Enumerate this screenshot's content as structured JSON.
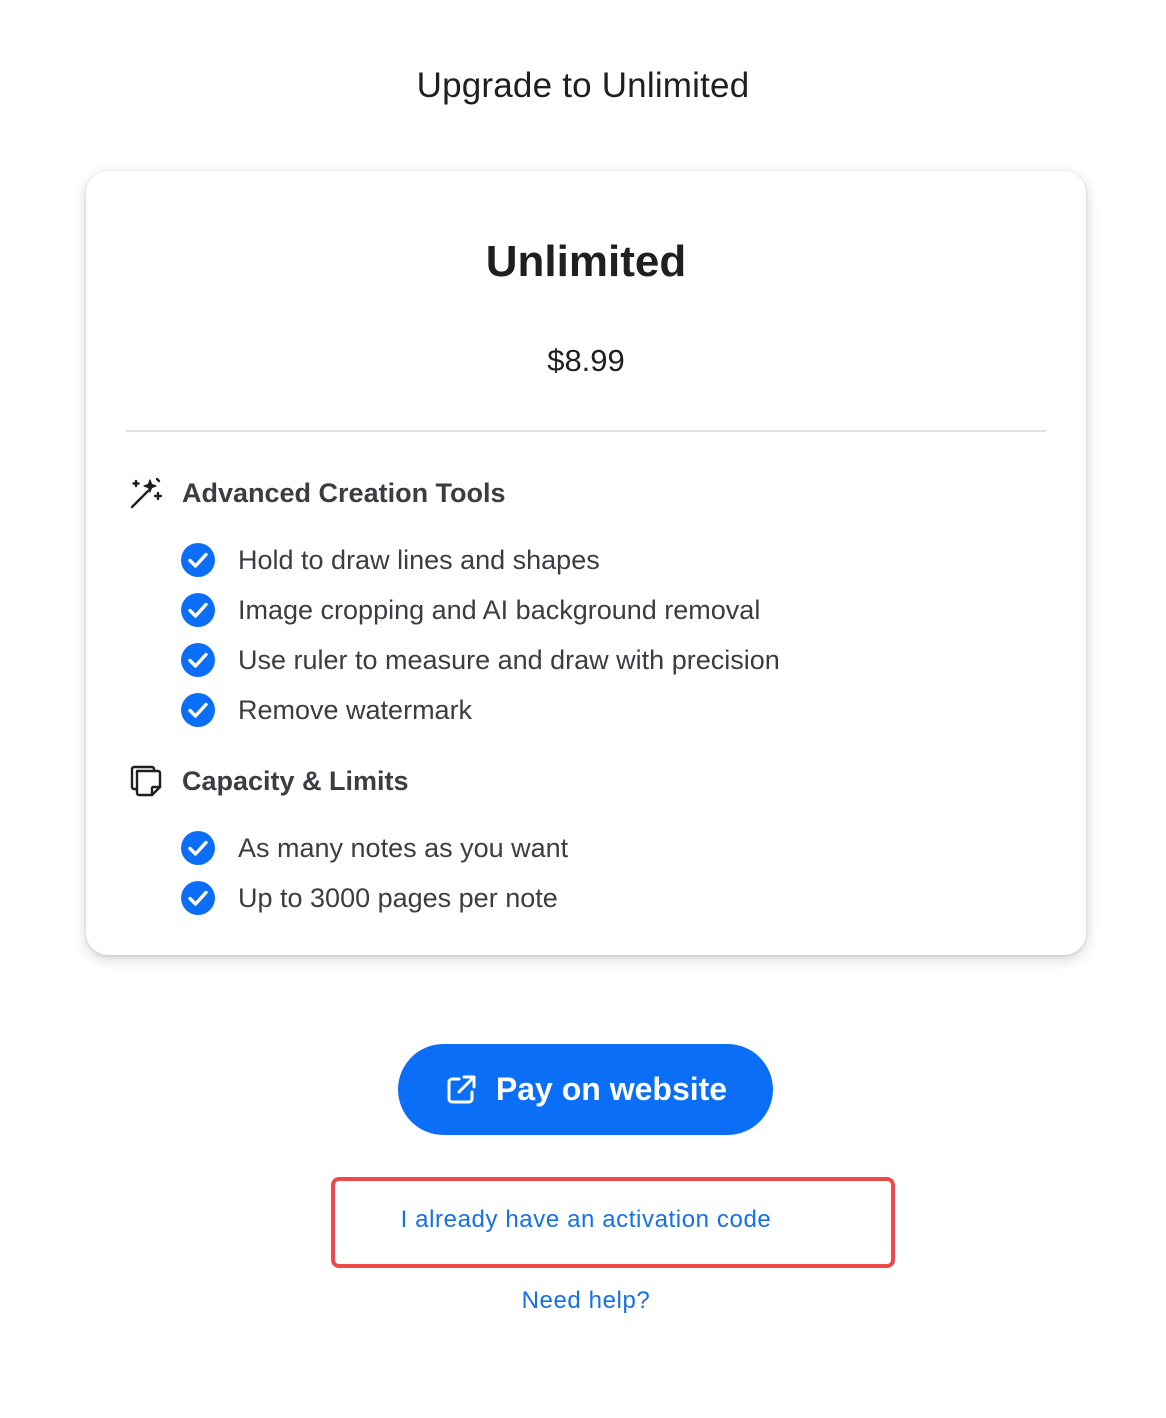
{
  "header": {
    "title": "Upgrade to Unlimited"
  },
  "plan": {
    "name": "Unlimited",
    "price": "$8.99",
    "sections": [
      {
        "icon": "magic-wand-icon",
        "title": "Advanced Creation Tools",
        "features": [
          "Hold to draw lines and shapes",
          "Image cropping and AI background removal",
          "Use ruler to measure and draw with precision",
          "Remove watermark"
        ]
      },
      {
        "icon": "stacked-pages-icon",
        "title": "Capacity & Limits",
        "features": [
          "As many notes as you want",
          "Up to 3000 pages per note"
        ]
      }
    ]
  },
  "actions": {
    "pay_label": "Pay on website",
    "pay_icon": "external-link-icon",
    "activation_label": "I already have an activation code",
    "help_label": "Need help?"
  },
  "colors": {
    "accent": "#0a6ef7",
    "link": "#1570e8",
    "check": "#0a6ef7",
    "highlight": "#ec4a48"
  }
}
